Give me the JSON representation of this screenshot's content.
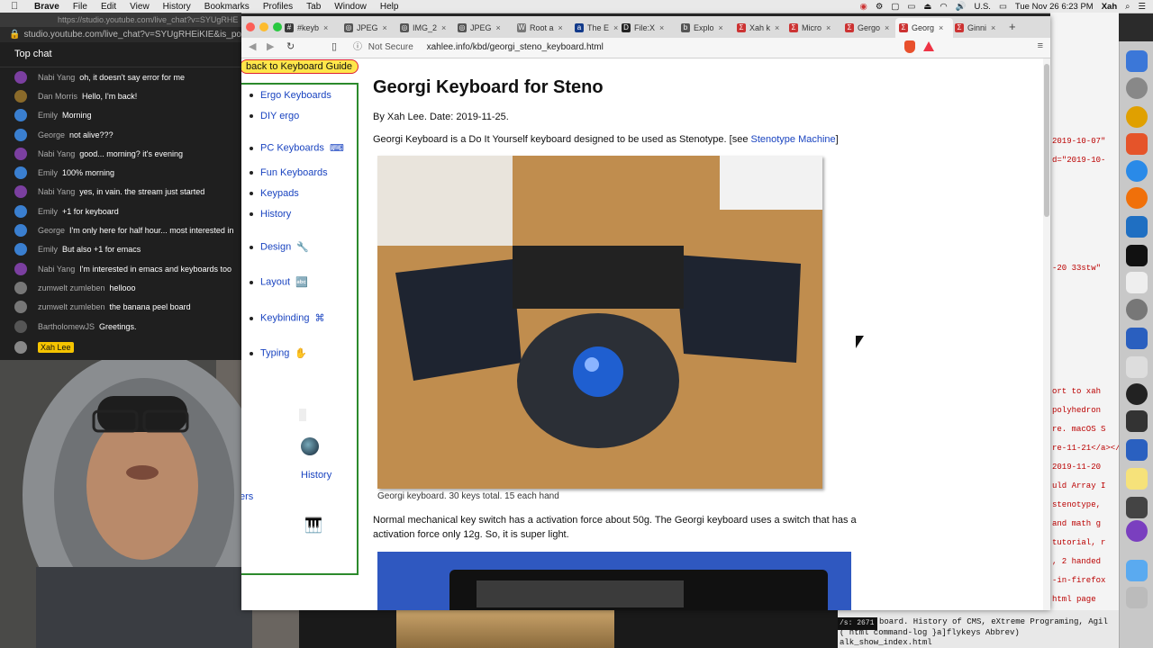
{
  "menubar": {
    "app": "Brave",
    "items": [
      "File",
      "Edit",
      "View",
      "History",
      "Bookmarks",
      "Profiles",
      "Tab",
      "Window",
      "Help"
    ],
    "status": {
      "input": "U.S.",
      "clock": "Tue Nov 26  6:23 PM",
      "user": "Xah"
    }
  },
  "youtube": {
    "tab_url": "https://studio.youtube.com/live_chat?v=SYUgRHE",
    "url": "studio.youtube.com/live_chat?v=SYUgRHEiKIE&is_popo",
    "header": "Top chat",
    "messages": [
      {
        "name": "Nabi Yang",
        "text": "oh, it doesn't say error for me",
        "color": "#7b3fa0"
      },
      {
        "name": "Dan Morris",
        "text": "Hello, I'm back!",
        "color": "#8a6a2a"
      },
      {
        "name": "Emily",
        "text": "Morning",
        "color": "#3a7fd0"
      },
      {
        "name": "George",
        "text": "not alive???",
        "color": "#3a7fd0"
      },
      {
        "name": "Nabi Yang",
        "text": "good... morning? it's evening",
        "color": "#7b3fa0"
      },
      {
        "name": "Emily",
        "text": "100% morning",
        "color": "#3a7fd0"
      },
      {
        "name": "Nabi Yang",
        "text": "yes, in vain. the stream just started",
        "color": "#7b3fa0"
      },
      {
        "name": "Emily",
        "text": "+1 for keyboard",
        "color": "#3a7fd0"
      },
      {
        "name": "George",
        "text": "I'm only here for half hour... most interested in",
        "color": "#3a7fd0"
      },
      {
        "name": "Emily",
        "text": "But also +1 for emacs",
        "color": "#3a7fd0"
      },
      {
        "name": "Nabi Yang",
        "text": "I'm interested in emacs and keyboards too",
        "color": "#7b3fa0"
      },
      {
        "name": "zumwelt zumleben",
        "text": "hellooo",
        "color": "#777777"
      },
      {
        "name": "zumwelt zumleben",
        "text": "the banana peel board",
        "color": "#777777"
      },
      {
        "name": "BartholomewJS",
        "text": "Greetings.",
        "color": "#555555"
      }
    ],
    "self_badge": "Xah Lee"
  },
  "browser": {
    "tabs": [
      {
        "label": "#keyb",
        "fav": "#",
        "favcolor": "#3a3a3a"
      },
      {
        "label": "JPEG",
        "fav": "◎",
        "favcolor": "#555"
      },
      {
        "label": "IMG_2",
        "fav": "◎",
        "favcolor": "#555"
      },
      {
        "label": "JPEG",
        "fav": "◎",
        "favcolor": "#555"
      },
      {
        "label": "Root a",
        "fav": "W",
        "favcolor": "#777"
      },
      {
        "label": "The E",
        "fav": "a",
        "favcolor": "#123a8a"
      },
      {
        "label": "File:X",
        "fav": "D",
        "favcolor": "#222"
      },
      {
        "label": "Explo",
        "fav": "b",
        "favcolor": "#555"
      },
      {
        "label": "Xah k",
        "fav": "Σ",
        "favcolor": "#c33"
      },
      {
        "label": "Micro",
        "fav": "Σ",
        "favcolor": "#c33"
      },
      {
        "label": "Gergo",
        "fav": "Σ",
        "favcolor": "#c33"
      },
      {
        "label": "Georg",
        "fav": "Σ",
        "favcolor": "#c33",
        "active": true
      },
      {
        "label": "Ginni",
        "fav": "Σ",
        "favcolor": "#c33"
      }
    ],
    "security": "Not Secure",
    "url": "xahlee.info/kbd/georgi_steno_keyboard.html"
  },
  "page": {
    "back_link": "back to Keyboard Guide",
    "nav": [
      {
        "label": "Ergo Keyboards",
        "icon": ""
      },
      {
        "label": "DIY ergo",
        "icon": ""
      },
      {
        "label": "PC Keyboards",
        "icon": "⌨"
      },
      {
        "label": "Fun Keyboards",
        "icon": ""
      },
      {
        "label": "Keypads",
        "icon": ""
      },
      {
        "label": "History",
        "icon": ""
      },
      {
        "label": "Design",
        "icon": "🔧"
      },
      {
        "label": "Layout",
        "icon": "🔤"
      },
      {
        "label": "Keybinding",
        "icon": "⌘"
      },
      {
        "label": "Typing",
        "icon": "✋"
      }
    ],
    "nav_partial": [
      "History",
      "ers"
    ],
    "title": "Georgi Keyboard for Steno",
    "byline": "By Xah Lee. Date: 2019-11-25.",
    "intro": "Georgi Keyboard is a Do It Yourself keyboard designed to be used as Stenotype. [see ",
    "intro_link": "Stenotype Machine",
    "intro_end": "]",
    "caption1": "Georgi keyboard. 30 keys total. 15 each hand",
    "para2": "Normal mechanical key switch has a activation force about 50g. The Georgi keyboard uses a switch that has a activation force only 12g. So, it is super light."
  },
  "editor": {
    "lines": [
      "2019-10-07\"",
      "d=\"2019-10-",
      "-20 33stw\"",
      "ort to xah",
      "polyhedron",
      "re. macOS S",
      "re-11-21</a></",
      "2019-11-20",
      "uld Array I",
      "stenotype,",
      "and math g",
      "tutorial, r",
      ", 2 handed",
      "-in-firefox",
      "html page"
    ],
    "bottom": [
      "board. History of CMS, eXtreme Programing, Agil",
      "( html command-log }a]flykeys Abbrev)",
      "alk_show_index.html"
    ],
    "counter": "/s: 2671"
  }
}
